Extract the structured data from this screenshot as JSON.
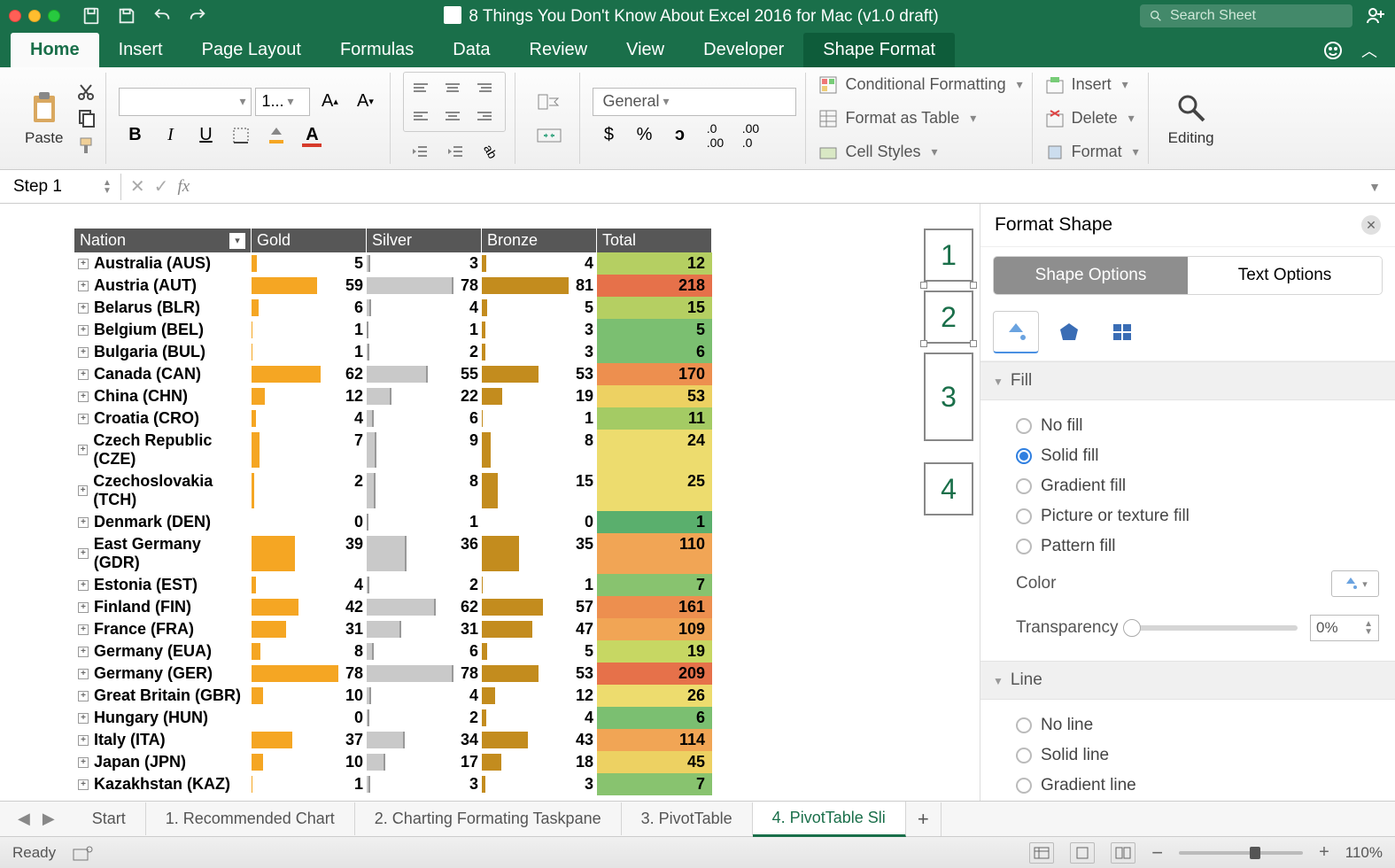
{
  "title": "8 Things You Don't Know About Excel 2016 for Mac (v1.0 draft)",
  "search_ph": "Search Sheet",
  "tabs": [
    "Home",
    "Insert",
    "Page Layout",
    "Formulas",
    "Data",
    "Review",
    "View",
    "Developer",
    "Shape Format"
  ],
  "paste_lbl": "Paste",
  "font_size": "1...",
  "num_format": "General",
  "editing_lbl": "Editing",
  "cond_fmt": "Conditional Formatting",
  "fmt_table": "Format as Table",
  "cell_styles": "Cell Styles",
  "btn_insert": "Insert",
  "btn_delete": "Delete",
  "btn_format": "Format",
  "namebox": "Step 1",
  "headers": {
    "nation": "Nation",
    "gold": "Gold",
    "silver": "Silver",
    "bronze": "Bronze",
    "total": "Total"
  },
  "rows": [
    {
      "n": "Australia (AUS)",
      "g": 5,
      "s": 3,
      "b": 4,
      "t": 12,
      "c": "#b5cf62"
    },
    {
      "n": "Austria (AUT)",
      "g": 59,
      "s": 78,
      "b": 81,
      "t": 218,
      "c": "#e6714a"
    },
    {
      "n": "Belarus (BLR)",
      "g": 6,
      "s": 4,
      "b": 5,
      "t": 15,
      "c": "#b5cf62"
    },
    {
      "n": "Belgium (BEL)",
      "g": 1,
      "s": 1,
      "b": 3,
      "t": 5,
      "c": "#7bbf71"
    },
    {
      "n": "Bulgaria (BUL)",
      "g": 1,
      "s": 2,
      "b": 3,
      "t": 6,
      "c": "#7bbf71"
    },
    {
      "n": "Canada (CAN)",
      "g": 62,
      "s": 55,
      "b": 53,
      "t": 170,
      "c": "#ed8f4f"
    },
    {
      "n": "China (CHN)",
      "g": 12,
      "s": 22,
      "b": 19,
      "t": 53,
      "c": "#edd162"
    },
    {
      "n": "Croatia (CRO)",
      "g": 4,
      "s": 6,
      "b": 1,
      "t": 11,
      "c": "#a4cb64"
    },
    {
      "n": "Czech Republic (CZE)",
      "g": 7,
      "s": 9,
      "b": 8,
      "t": 24,
      "c": "#eddc6e"
    },
    {
      "n": "Czechoslovakia (TCH)",
      "g": 2,
      "s": 8,
      "b": 15,
      "t": 25,
      "c": "#eddc6e"
    },
    {
      "n": "Denmark (DEN)",
      "g": 0,
      "s": 1,
      "b": 0,
      "t": 1,
      "c": "#5aaf6d"
    },
    {
      "n": "East Germany (GDR)",
      "g": 39,
      "s": 36,
      "b": 35,
      "t": 110,
      "c": "#f1a555"
    },
    {
      "n": "Estonia (EST)",
      "g": 4,
      "s": 2,
      "b": 1,
      "t": 7,
      "c": "#88c36f"
    },
    {
      "n": "Finland (FIN)",
      "g": 42,
      "s": 62,
      "b": 57,
      "t": 161,
      "c": "#ed8f4f"
    },
    {
      "n": "France (FRA)",
      "g": 31,
      "s": 31,
      "b": 47,
      "t": 109,
      "c": "#f1a555"
    },
    {
      "n": "Germany (EUA)",
      "g": 8,
      "s": 6,
      "b": 5,
      "t": 19,
      "c": "#c7d763"
    },
    {
      "n": "Germany (GER)",
      "g": 78,
      "s": 78,
      "b": 53,
      "t": 209,
      "c": "#e6714a"
    },
    {
      "n": "Great Britain (GBR)",
      "g": 10,
      "s": 4,
      "b": 12,
      "t": 26,
      "c": "#eddc6e"
    },
    {
      "n": "Hungary (HUN)",
      "g": 0,
      "s": 2,
      "b": 4,
      "t": 6,
      "c": "#7bbf71"
    },
    {
      "n": "Italy (ITA)",
      "g": 37,
      "s": 34,
      "b": 43,
      "t": 114,
      "c": "#f1a555"
    },
    {
      "n": "Japan (JPN)",
      "g": 10,
      "s": 17,
      "b": 18,
      "t": 45,
      "c": "#edd162"
    },
    {
      "n": "Kazakhstan (KAZ)",
      "g": 1,
      "s": 3,
      "b": 3,
      "t": 7,
      "c": "#88c36f"
    }
  ],
  "max": {
    "g": 78,
    "s": 78,
    "b": 81
  },
  "shape_nums": [
    "1",
    "2",
    "3",
    "4"
  ],
  "panel": {
    "title": "Format Shape",
    "shape_opts": "Shape Options",
    "text_opts": "Text Options",
    "fill": "Fill",
    "line": "Line",
    "no_fill": "No fill",
    "solid_fill": "Solid fill",
    "grad_fill": "Gradient fill",
    "pic_fill": "Picture or texture fill",
    "pat_fill": "Pattern fill",
    "color": "Color",
    "transp": "Transparency",
    "pct": "0%",
    "no_line": "No line",
    "solid_line": "Solid line",
    "grad_line": "Gradient line"
  },
  "sheets": [
    "Start",
    "1. Recommended Chart",
    "2. Charting Formating Taskpane",
    "3. PivotTable",
    "4. PivotTable Sli"
  ],
  "status": "Ready",
  "zoom": "110%"
}
